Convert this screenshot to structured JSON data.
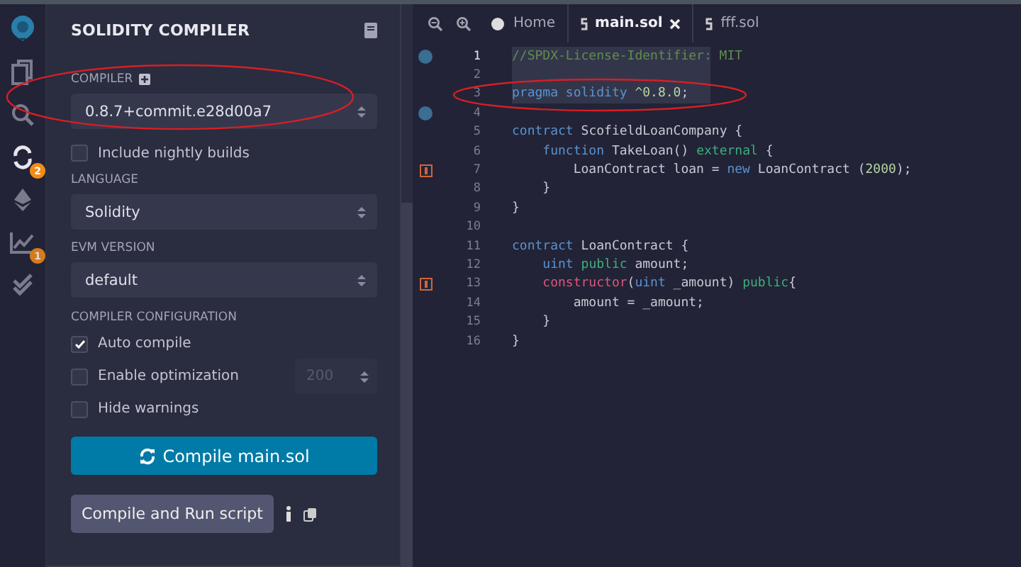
{
  "sidebar": {
    "icons": [
      {
        "kind": "logo",
        "selected": false
      },
      {
        "kind": "files",
        "selected": false
      },
      {
        "kind": "search",
        "selected": false
      },
      {
        "kind": "compiler",
        "selected": true,
        "badge": "2"
      },
      {
        "kind": "deploy",
        "selected": false
      },
      {
        "kind": "analysis",
        "selected": false,
        "badge": "1"
      },
      {
        "kind": "verify",
        "selected": false
      }
    ]
  },
  "panel": {
    "title": "SOLIDITY COMPILER",
    "compiler": {
      "label": "COMPILER",
      "value": "0.8.7+commit.e28d00a7",
      "circled": true
    },
    "nightly": {
      "label": "Include nightly builds",
      "checked": false
    },
    "language": {
      "label": "LANGUAGE",
      "value": "Solidity"
    },
    "evm": {
      "label": "EVM VERSION",
      "value": "default"
    },
    "config": {
      "label": "COMPILER CONFIGURATION",
      "options": [
        {
          "label": "Auto compile",
          "checked": true
        },
        {
          "label": "Enable optimization",
          "checked": false,
          "runs": "200"
        },
        {
          "label": "Hide warnings",
          "checked": false
        }
      ]
    },
    "compile_button": "Compile main.sol",
    "run_button": "Compile and Run script"
  },
  "editor": {
    "tabs": [
      {
        "kind": "home",
        "label": "Home",
        "selected": false
      },
      {
        "kind": "file",
        "label": "main.sol",
        "selected": true
      },
      {
        "kind": "file",
        "label": "fff.sol",
        "selected": false
      }
    ],
    "lines": [
      {
        "number": "1",
        "kind": "breakpoint",
        "highlighted": true,
        "circled": false,
        "tokens": [
          {
            "text": "//SPDX-License-Identifier: MIT",
            "kind": "comment"
          }
        ]
      },
      {
        "number": "2",
        "kind": "plain",
        "highlighted": true,
        "circled": false
      },
      {
        "number": "3",
        "kind": "plain",
        "highlighted": true,
        "circled": true,
        "tokens": [
          {
            "text": "pragma solidity ",
            "kind": "keyword"
          },
          {
            "text": "^0.8.0",
            "kind": "number"
          },
          {
            "text": ";",
            "kind": "plain"
          }
        ]
      },
      {
        "number": "4",
        "kind": "breakpoint",
        "highlighted": false,
        "circled": false
      },
      {
        "number": "5",
        "kind": "plain",
        "highlighted": false,
        "circled": false,
        "tokens": [
          {
            "text": "contract ",
            "kind": "keyword"
          },
          {
            "text": "ScofieldLoanCompany {",
            "kind": "plain"
          }
        ]
      },
      {
        "number": "6",
        "kind": "plain",
        "highlighted": false,
        "circled": false,
        "tokens": [
          {
            "text": "    function ",
            "kind": "keyword"
          },
          {
            "text": "TakeLoan() ",
            "kind": "plain"
          },
          {
            "text": "external",
            "kind": "modifier"
          },
          {
            "text": " {",
            "kind": "plain"
          }
        ]
      },
      {
        "number": "7",
        "kind": "warning",
        "highlighted": false,
        "circled": false,
        "tokens": [
          {
            "text": "        LoanContract loan = ",
            "kind": "plain"
          },
          {
            "text": "new",
            "kind": "keyword"
          },
          {
            "text": " LoanContract (",
            "kind": "plain"
          },
          {
            "text": "2000",
            "kind": "number"
          },
          {
            "text": ");",
            "kind": "plain"
          }
        ]
      },
      {
        "number": "8",
        "kind": "plain",
        "highlighted": false,
        "circled": false,
        "tokens": [
          {
            "text": "    }",
            "kind": "plain"
          }
        ]
      },
      {
        "number": "9",
        "kind": "plain",
        "highlighted": false,
        "circled": false,
        "tokens": [
          {
            "text": "}",
            "kind": "plain"
          }
        ]
      },
      {
        "number": "10",
        "kind": "plain",
        "highlighted": false,
        "circled": false
      },
      {
        "number": "11",
        "kind": "plain",
        "highlighted": false,
        "circled": false,
        "tokens": [
          {
            "text": "contract ",
            "kind": "keyword"
          },
          {
            "text": "LoanContract {",
            "kind": "plain"
          }
        ]
      },
      {
        "number": "12",
        "kind": "plain",
        "highlighted": false,
        "circled": false,
        "tokens": [
          {
            "text": "    uint ",
            "kind": "keyword"
          },
          {
            "text": "public",
            "kind": "modifier"
          },
          {
            "text": " amount;",
            "kind": "plain"
          }
        ]
      },
      {
        "number": "13",
        "kind": "warning",
        "highlighted": false,
        "circled": false,
        "tokens": [
          {
            "text": "    constructor",
            "kind": "special"
          },
          {
            "text": "(",
            "kind": "plain"
          },
          {
            "text": "uint",
            "kind": "keyword"
          },
          {
            "text": " _amount) ",
            "kind": "plain"
          },
          {
            "text": "public",
            "kind": "modifier"
          },
          {
            "text": "{",
            "kind": "plain"
          }
        ]
      },
      {
        "number": "14",
        "kind": "plain",
        "highlighted": false,
        "circled": false,
        "tokens": [
          {
            "text": "        amount = _amount;",
            "kind": "plain"
          }
        ]
      },
      {
        "number": "15",
        "kind": "plain",
        "highlighted": false,
        "circled": false,
        "tokens": [
          {
            "text": "    }",
            "kind": "plain"
          }
        ]
      },
      {
        "number": "16",
        "kind": "plain",
        "highlighted": false,
        "circled": false,
        "tokens": [
          {
            "text": "}",
            "kind": "plain"
          }
        ]
      }
    ]
  }
}
